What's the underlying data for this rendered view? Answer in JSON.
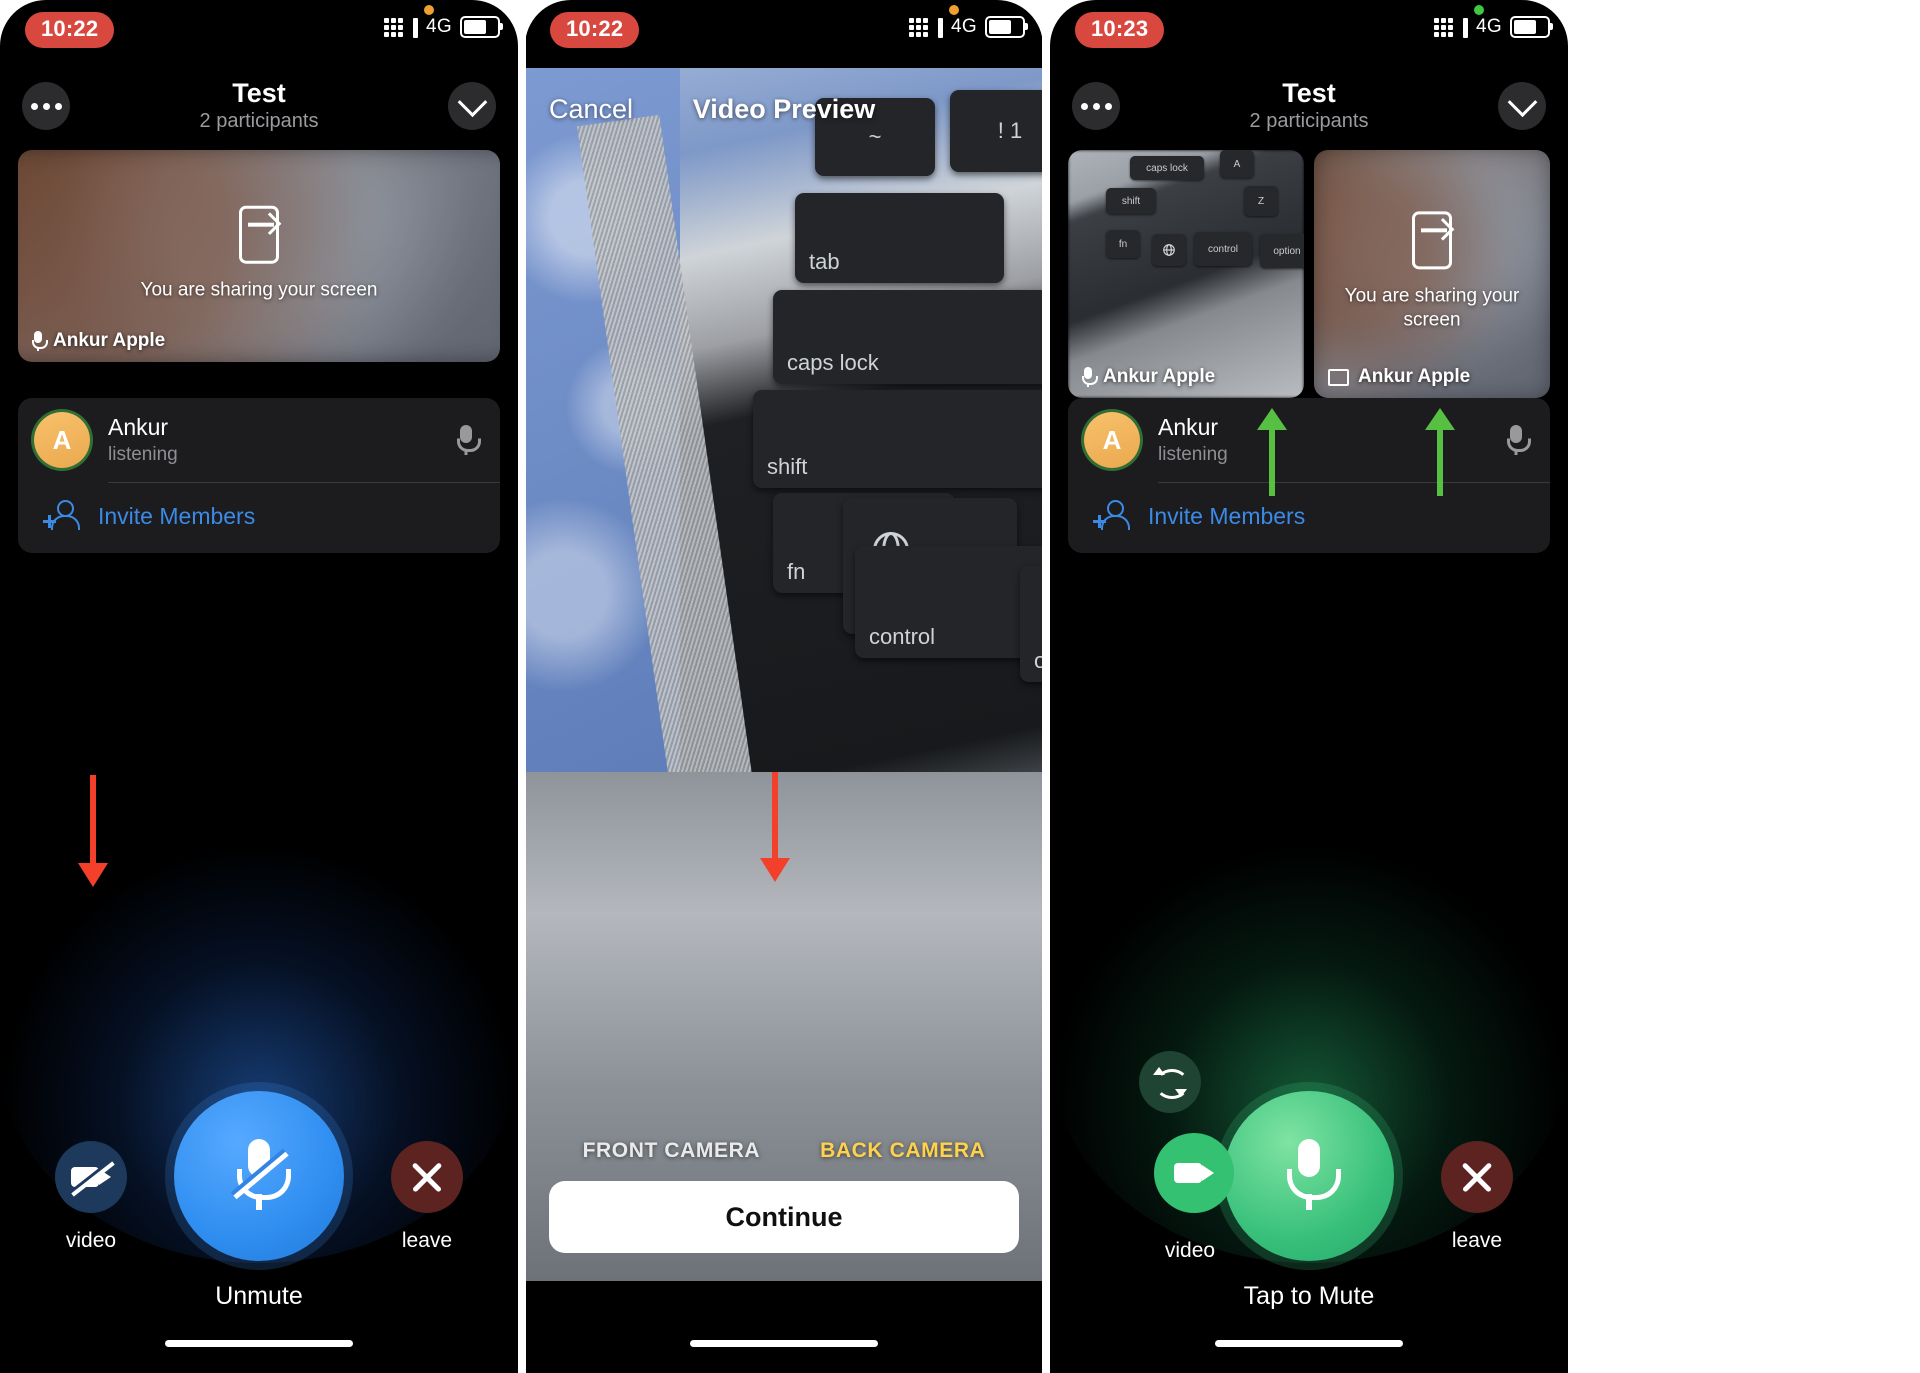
{
  "page": {
    "title": "Telegram group voice chat — screen sharing and video camera controls",
    "background": "#ffffff"
  },
  "colors": {
    "accent_blue": "#3b8ae5",
    "mute_blue": "#2f8ef0",
    "unmute_green": "#37c07a",
    "leave_red": "#5c2320",
    "time_pill_red": "#d9483f",
    "highlight_yellow": "#ffd24d",
    "annotation_red": "#f2402b",
    "annotation_green": "#57c043",
    "avatar_orange": "#eaa94f"
  },
  "panels": [
    {
      "id": "panel-sharing-muted",
      "status": {
        "time": "10:22",
        "privacy_dot": "orange",
        "network": "4G",
        "battery_level": 62
      },
      "header": {
        "more_icon": "more-dots-icon",
        "title": "Test",
        "subtitle": "2 participants",
        "collapse_icon": "chevron-down-icon"
      },
      "share_tile": {
        "icon": "screen-share-icon",
        "message": "You are sharing your screen",
        "name": "Ankur Apple",
        "name_icon": "microphone-icon"
      },
      "participants": [
        {
          "avatar_letter": "A",
          "name": "Ankur",
          "state": "listening",
          "mic_icon": "microphone-icon"
        }
      ],
      "invite": {
        "icon": "person-add-icon",
        "label": "Invite Members"
      },
      "controls": {
        "video_label": "video",
        "video_icon": "video-off-icon",
        "main_label": "Unmute",
        "main_icon": "microphone-muted-icon",
        "leave_label": "leave",
        "leave_icon": "close-x-icon"
      },
      "annotation": {
        "type": "arrow-down",
        "color": "#f2402b",
        "points_to": "video-button"
      }
    },
    {
      "id": "panel-video-preview",
      "status": {
        "time": "10:22",
        "privacy_dot": "orange",
        "network": "4G",
        "battery_level": 62
      },
      "preview": {
        "cancel_label": "Cancel",
        "title": "Video Preview",
        "camera_options": [
          {
            "label": "FRONT CAMERA",
            "selected": false
          },
          {
            "label": "BACK CAMERA",
            "selected": true
          }
        ],
        "continue_label": "Continue",
        "keys": [
          "~",
          "!",
          "tab",
          "caps lock",
          "shift",
          "fn",
          "control",
          "op"
        ]
      },
      "annotation": {
        "type": "arrow-down",
        "color": "#f2402b",
        "points_to": "back-camera-option"
      }
    },
    {
      "id": "panel-video-on",
      "status": {
        "time": "10:23",
        "privacy_dot": "green",
        "network": "4G",
        "battery_level": 62
      },
      "header": {
        "more_icon": "more-dots-icon",
        "title": "Test",
        "subtitle": "2 participants",
        "collapse_icon": "chevron-down-icon"
      },
      "tiles": [
        {
          "name": "Ankur Apple",
          "name_icon": "microphone-icon",
          "content": "camera-feed-keyboard"
        },
        {
          "name": "Ankur Apple",
          "name_icon": "screen-share-small-icon",
          "message": "You are sharing your screen",
          "icon": "screen-share-icon"
        }
      ],
      "participants": [
        {
          "avatar_letter": "A",
          "name": "Ankur",
          "state": "listening",
          "mic_icon": "microphone-icon"
        }
      ],
      "invite": {
        "icon": "person-add-icon",
        "label": "Invite Members"
      },
      "controls": {
        "flip_icon": "flip-camera-icon",
        "video_label": "video",
        "video_icon": "video-on-icon",
        "main_label": "Tap to Mute",
        "main_icon": "microphone-icon",
        "leave_label": "leave",
        "leave_icon": "close-x-icon"
      },
      "annotations": [
        {
          "type": "arrow-up",
          "color": "#57c043",
          "points_to": "camera-tile"
        },
        {
          "type": "arrow-up",
          "color": "#57c043",
          "points_to": "screen-share-tile"
        }
      ]
    }
  ],
  "preview_keycaps": {
    "tilde": "~",
    "one": "!\n1",
    "tab": "tab",
    "caps": "caps lock",
    "shift": "shift",
    "fn": "fn",
    "control": "control",
    "option": "op",
    "globe": "globe-icon",
    "caret": "^"
  },
  "tile_keycaps": {
    "caps_lock": "caps lock",
    "a": "A",
    "shift": "shift",
    "z": "Z",
    "fn": "fn",
    "control": "control",
    "option": "option",
    "co": "co",
    "globe": "globe-icon",
    "caret": "^",
    "alt": "⌥"
  }
}
